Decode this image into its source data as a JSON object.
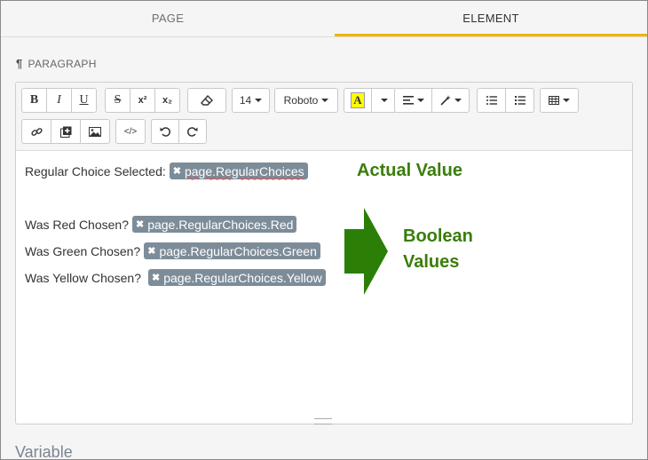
{
  "tabs": [
    {
      "label": "PAGE"
    },
    {
      "label": "ELEMENT"
    }
  ],
  "section": {
    "icon": "paragraph-icon",
    "label": "PARAGRAPH"
  },
  "toolbar": {
    "font_size": "14",
    "font_family": "Roboto",
    "bold": "B",
    "italic": "I",
    "underline": "U",
    "strike": "S",
    "superscript": "x²",
    "subscript": "x₂"
  },
  "content": {
    "line1": {
      "label": "Regular Choice Selected:",
      "chip": "page.RegularChoices"
    },
    "line2": {
      "label": "Was Red Chosen?",
      "chip": "page.RegularChoices.Red"
    },
    "line3": {
      "label": "Was Green Chosen?",
      "chip": "page.RegularChoices.Green"
    },
    "line4": {
      "label": "Was Yellow Chosen?",
      "chip": "page.RegularChoices.Yellow"
    }
  },
  "annotations": {
    "actual": "Actual Value",
    "boolean_1": "Boolean",
    "boolean_2": "Values",
    "color": "#2b7f07"
  },
  "bottom": {
    "label": "Variable"
  }
}
